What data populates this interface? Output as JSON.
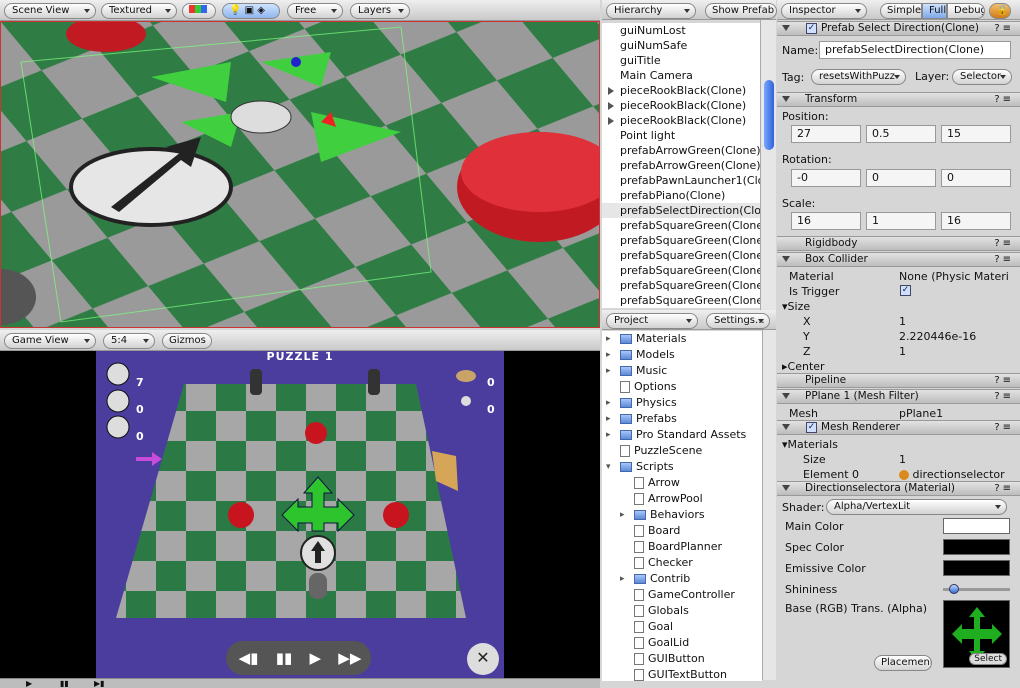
{
  "scene_toolbar": {
    "view": "Scene View",
    "mode": "Textured",
    "camera": "Free",
    "layers": "Layers"
  },
  "game_toolbar": {
    "view": "Game View",
    "aspect": "5:4",
    "gizmos": "Gizmos"
  },
  "game": {
    "title": "PUZZLE 1",
    "counts_left": [
      "7",
      "0",
      "0"
    ],
    "counts_right": [
      "0",
      "0"
    ]
  },
  "hierarchy": {
    "tab": "Hierarchy",
    "button": "Show Prefab",
    "items": [
      {
        "label": "guiNumLost",
        "arrow": false
      },
      {
        "label": "guiNumSafe",
        "arrow": false
      },
      {
        "label": "guiTitle",
        "arrow": false
      },
      {
        "label": "Main Camera",
        "arrow": false
      },
      {
        "label": "pieceRookBlack(Clone)",
        "arrow": true
      },
      {
        "label": "pieceRookBlack(Clone)",
        "arrow": true
      },
      {
        "label": "pieceRookBlack(Clone)",
        "arrow": true
      },
      {
        "label": "Point light",
        "arrow": false
      },
      {
        "label": "prefabArrowGreen(Clone)",
        "arrow": false
      },
      {
        "label": "prefabArrowGreen(Clone)",
        "arrow": false
      },
      {
        "label": "prefabPawnLauncher1(Clo",
        "arrow": false
      },
      {
        "label": "prefabPiano(Clone)",
        "arrow": false
      },
      {
        "label": "prefabSelectDirection(Clor",
        "arrow": false
      },
      {
        "label": "prefabSquareGreen(Clone)",
        "arrow": false
      },
      {
        "label": "prefabSquareGreen(Clone)",
        "arrow": false
      },
      {
        "label": "prefabSquareGreen(Clone)",
        "arrow": false
      },
      {
        "label": "prefabSquareGreen(Clone)",
        "arrow": false
      },
      {
        "label": "prefabSquareGreen(Clone)",
        "arrow": false
      },
      {
        "label": "prefabSquareGreen(Clone)",
        "arrow": false
      }
    ]
  },
  "project": {
    "tab": "Project",
    "button": "Settings...",
    "items": [
      {
        "label": "Materials",
        "kind": "folder",
        "indent": 0,
        "arrow": true
      },
      {
        "label": "Models",
        "kind": "folder",
        "indent": 0,
        "arrow": true
      },
      {
        "label": "Music",
        "kind": "folder",
        "indent": 0,
        "arrow": true
      },
      {
        "label": "Options",
        "kind": "file",
        "indent": 0,
        "arrow": false
      },
      {
        "label": "Physics",
        "kind": "folder",
        "indent": 0,
        "arrow": true
      },
      {
        "label": "Prefabs",
        "kind": "folder",
        "indent": 0,
        "arrow": true
      },
      {
        "label": "Pro Standard Assets",
        "kind": "folder",
        "indent": 0,
        "arrow": true
      },
      {
        "label": "PuzzleScene",
        "kind": "file",
        "indent": 0,
        "arrow": false
      },
      {
        "label": "Scripts",
        "kind": "folder",
        "indent": 0,
        "arrow": true,
        "open": true
      },
      {
        "label": "Arrow",
        "kind": "doc",
        "indent": 1,
        "arrow": false
      },
      {
        "label": "ArrowPool",
        "kind": "doc",
        "indent": 1,
        "arrow": false
      },
      {
        "label": "Behaviors",
        "kind": "folder",
        "indent": 1,
        "arrow": true
      },
      {
        "label": "Board",
        "kind": "doc",
        "indent": 1,
        "arrow": false
      },
      {
        "label": "BoardPlanner",
        "kind": "doc",
        "indent": 1,
        "arrow": false
      },
      {
        "label": "Checker",
        "kind": "doc",
        "indent": 1,
        "arrow": false
      },
      {
        "label": "Contrib",
        "kind": "folder",
        "indent": 1,
        "arrow": true
      },
      {
        "label": "GameController",
        "kind": "doc",
        "indent": 1,
        "arrow": false
      },
      {
        "label": "Globals",
        "kind": "doc",
        "indent": 1,
        "arrow": false
      },
      {
        "label": "Goal",
        "kind": "doc",
        "indent": 1,
        "arrow": false
      },
      {
        "label": "GoalLid",
        "kind": "doc",
        "indent": 1,
        "arrow": false
      },
      {
        "label": "GUIButton",
        "kind": "doc",
        "indent": 1,
        "arrow": false
      },
      {
        "label": "GUITextButton",
        "kind": "doc",
        "indent": 1,
        "arrow": false
      }
    ]
  },
  "inspector": {
    "tab": "Inspector",
    "simple": "Simple",
    "full": "Full",
    "debug": "Debug",
    "object_title": "Prefab Select Direction(Clone)",
    "name_label": "Name:",
    "name_value": "prefabSelectDirection(Clone)",
    "tag_label": "Tag:",
    "tag_value": "resetsWithPuzz",
    "layer_label": "Layer:",
    "layer_value": "Selector",
    "transform": {
      "title": "Transform",
      "position_label": "Position:",
      "position": [
        "27",
        "0.5",
        "15"
      ],
      "rotation_label": "Rotation:",
      "rotation": [
        "-0",
        "0",
        "0"
      ],
      "scale_label": "Scale:",
      "scale": [
        "16",
        "1",
        "16"
      ]
    },
    "rigidbody": "Rigidbody",
    "box_collider": {
      "title": "Box Collider",
      "material_label": "Material",
      "material_value": "None (Physic Materi",
      "is_trigger_label": "Is Trigger",
      "size_label": "Size",
      "x_label": "X",
      "x": "1",
      "y_label": "Y",
      "y": "2.220446e-16",
      "z_label": "Z",
      "z": "1",
      "center_label": "Center"
    },
    "pipeline": "Pipeline",
    "mesh_filter": {
      "title": "PPlane 1 (Mesh Filter)",
      "mesh_label": "Mesh",
      "mesh_value": "pPlane1"
    },
    "mesh_renderer": {
      "title": "Mesh Renderer",
      "materials_label": "Materials",
      "size_label": "Size",
      "size": "1",
      "element_label": "Element 0",
      "element_value": "directionselector"
    },
    "material": {
      "title": "Directionselectora (Material)",
      "shader_label": "Shader:",
      "shader_value": "Alpha/VertexLit",
      "main_color": "Main Color",
      "spec_color": "Spec Color",
      "emissive_color": "Emissive Color",
      "shininess": "Shininess",
      "shininess_value": 0.1,
      "base_label": "Base (RGB) Trans. (Alpha)",
      "placement": "Placement",
      "select": "Select"
    }
  },
  "colors": {
    "main": "#ffffff",
    "spec": "#000000",
    "emissive": "#000000"
  }
}
